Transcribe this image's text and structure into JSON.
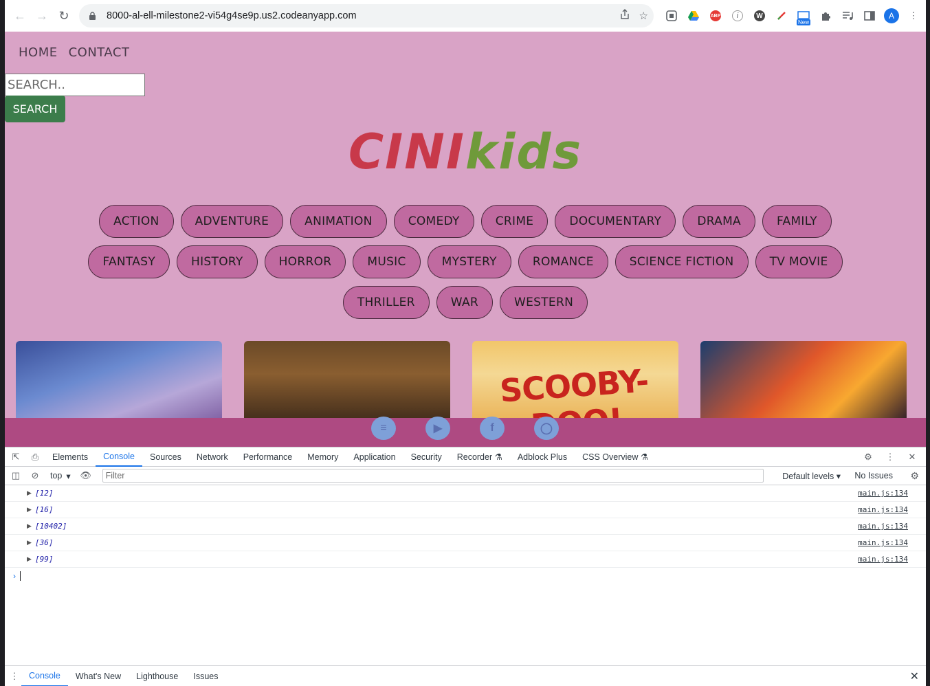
{
  "browser": {
    "url": "8000-al-ell-milestone2-vi54g4se9p.us2.codeanyapp.com",
    "avatar_letter": "A",
    "new_badge": "New",
    "abp_label": "ABP"
  },
  "site": {
    "nav": [
      "HOME",
      "CONTACT"
    ],
    "search_placeholder": "SEARCH..",
    "search_button": "SEARCH",
    "logo_part1": "CINI",
    "logo_part2": "kids",
    "genre_rows": [
      [
        "ACTION",
        "ADVENTURE",
        "ANIMATION",
        "COMEDY",
        "CRIME",
        "DOCUMENTARY",
        "DRAMA",
        "FAMILY"
      ],
      [
        "FANTASY",
        "HISTORY",
        "HORROR",
        "MUSIC",
        "MYSTERY",
        "ROMANCE",
        "SCIENCE FICTION",
        "TV MOVIE"
      ],
      [
        "THRILLER",
        "WAR",
        "WESTERN"
      ]
    ],
    "poster_text": "SCOOBY-DOO!",
    "social_icons": [
      "list-icon",
      "youtube-icon",
      "facebook-icon",
      "instagram-icon"
    ],
    "colors": {
      "background": "#d9a3c6",
      "genre_pill": "#c06aa0",
      "footer": "#ae4a82",
      "search_button": "#3c7d4b",
      "logo_red": "#c8394a",
      "logo_green": "#6f9a3a"
    }
  },
  "devtools": {
    "tabs": [
      "Elements",
      "Console",
      "Sources",
      "Network",
      "Performance",
      "Memory",
      "Application",
      "Security",
      "Recorder",
      "Adblock Plus",
      "CSS Overview"
    ],
    "active_tab": "Console",
    "context": "top",
    "filter_placeholder": "Filter",
    "levels": "Default levels",
    "issues": "No Issues",
    "logs": [
      {
        "value": "[12]",
        "source": "main.js:134"
      },
      {
        "value": "[16]",
        "source": "main.js:134"
      },
      {
        "value": "[10402]",
        "source": "main.js:134"
      },
      {
        "value": "[36]",
        "source": "main.js:134"
      },
      {
        "value": "[99]",
        "source": "main.js:134"
      }
    ],
    "drawer_tabs": [
      "Console",
      "What's New",
      "Lighthouse",
      "Issues"
    ]
  }
}
